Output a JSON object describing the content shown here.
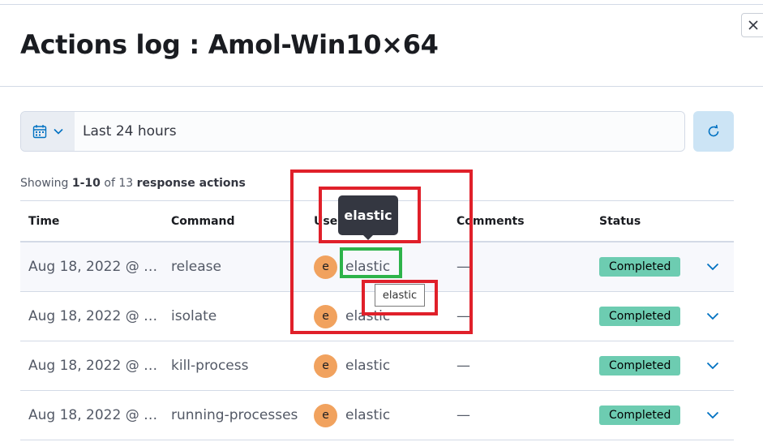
{
  "flyout": {
    "title": "Actions log : Amol-Win10×64"
  },
  "datepicker": {
    "value": "Last 24 hours"
  },
  "summary": {
    "prefix": "Showing ",
    "range": "1-10",
    "middle": " of 13 ",
    "noun": "response actions"
  },
  "table": {
    "headers": [
      "Time",
      "Command",
      "User",
      "Comments",
      "Status"
    ],
    "rows": [
      {
        "time": "Aug 18, 2022 @ …",
        "command": "release",
        "user_initial": "e",
        "user": "elastic",
        "comment": "—",
        "status": "Completed"
      },
      {
        "time": "Aug 18, 2022 @ …",
        "command": "isolate",
        "user_initial": "e",
        "user": "elastic",
        "comment": "—",
        "status": "Completed"
      },
      {
        "time": "Aug 18, 2022 @ …",
        "command": "kill-process",
        "user_initial": "e",
        "user": "elastic",
        "comment": "—",
        "status": "Completed"
      },
      {
        "time": "Aug 18, 2022 @ …",
        "command": "running-processes",
        "user_initial": "e",
        "user": "elastic",
        "comment": "—",
        "status": "Completed"
      }
    ]
  },
  "tooltips": {
    "dark": "elastic",
    "light": "elastic"
  },
  "colors": {
    "annotation_red": "#e0202a",
    "annotation_green": "#2db34a",
    "status_completed": "#6dccb1",
    "avatar": "#f1a25e"
  },
  "icons": {
    "close": "close-icon",
    "calendar": "calendar-icon",
    "chevron": "chevron-down-icon",
    "refresh": "refresh-icon"
  }
}
